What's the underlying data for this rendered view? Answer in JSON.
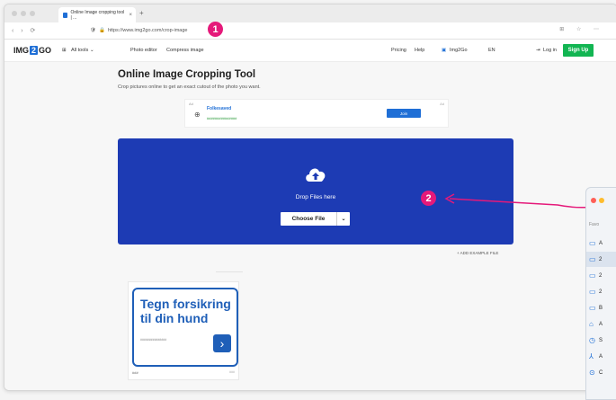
{
  "browser": {
    "tab_title": "Online Image cropping tool | ...",
    "url": "https://www.img2go.com/crop-image",
    "url_domain": "img2go.com"
  },
  "site": {
    "logo_img": "IMG",
    "logo_2": "2",
    "logo_go": "GO",
    "nav_all_tools": "All tools",
    "nav_photo_editor": "Photo editor",
    "nav_compress": "Compress image",
    "nav_pricing": "Pricing",
    "nav_help": "Help",
    "nav_img2go": "Img2Go",
    "nav_lang": "EN",
    "nav_login": "Log in",
    "nav_signup": "Sign Up"
  },
  "main": {
    "title": "Online Image Cropping Tool",
    "subtitle": "Crop pictures online to get an exact cutout of the photo you want.",
    "drop_text": "Drop Files here",
    "choose_file": "Choose File",
    "add_example": "ADD EXAMPLE FILE"
  },
  "ad_top": {
    "sponsored": "Ad",
    "name": "Folkesaved",
    "phone": "###############",
    "cta": "Join",
    "ad_choice": "Ad"
  },
  "ad_side": {
    "headline": "Tegn forsikring til din hund",
    "small": "###############",
    "footer": "###",
    "footer2": "###"
  },
  "annotations": {
    "badge1": "1",
    "badge2": "2",
    "pink": "#e5197a"
  },
  "finder": {
    "header": "Favo",
    "rows": [
      "A",
      "2",
      "2",
      "2",
      "B",
      "A",
      "S",
      "A",
      "C"
    ]
  }
}
